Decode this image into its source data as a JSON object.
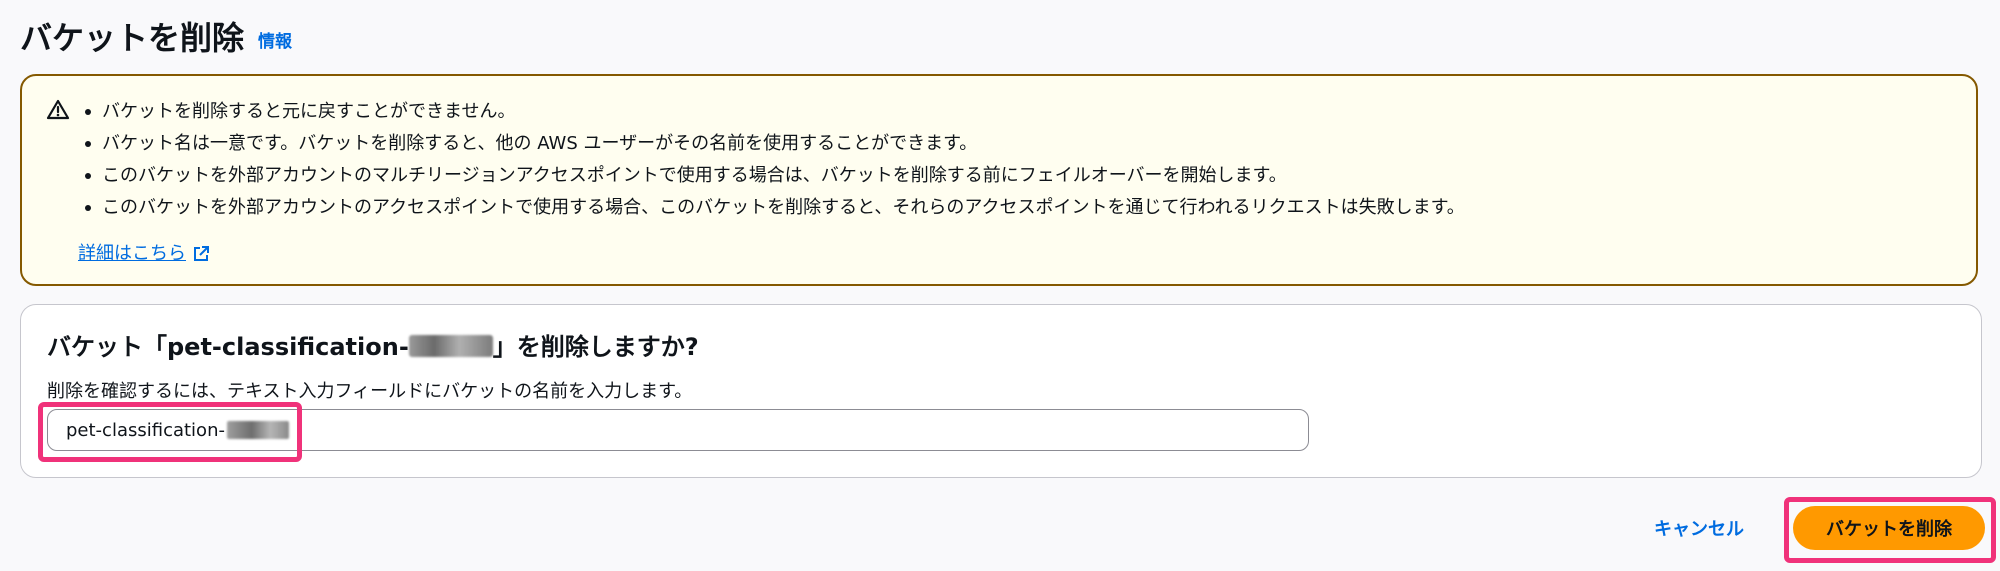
{
  "header": {
    "title": "バケットを削除",
    "info_link": "情報"
  },
  "warning": {
    "icon": "warning-icon",
    "items": [
      "バケットを削除すると元に戻すことができません。",
      "バケット名は一意です。バケットを削除すると、他の AWS ユーザーがその名前を使用することができます。",
      "このバケットを外部アカウントのマルチリージョンアクセスポイントで使用する場合は、バケットを削除する前にフェイルオーバーを開始します。",
      "このバケットを外部アカウントのアクセスポイントで使用する場合、このバケットを削除すると、それらのアクセスポイントを通じて行われるリクエストは失敗します。"
    ],
    "learn_more": "詳細はこちら",
    "learn_more_icon": "external-link-icon"
  },
  "confirm": {
    "heading_prefix": "バケット「pet-classification-",
    "heading_suffix": "」を削除しますか?",
    "description": "削除を確認するには、テキスト入力フィールドにバケットの名前を入力します。",
    "input_value": "pet-classification-"
  },
  "actions": {
    "cancel_label": "キャンセル",
    "delete_label": "バケットを削除"
  },
  "colors": {
    "primary_button": "#ff9900",
    "link": "#006ce0",
    "warning_border": "#855900",
    "warning_background": "#fffef0",
    "highlight": "#f0327a"
  }
}
